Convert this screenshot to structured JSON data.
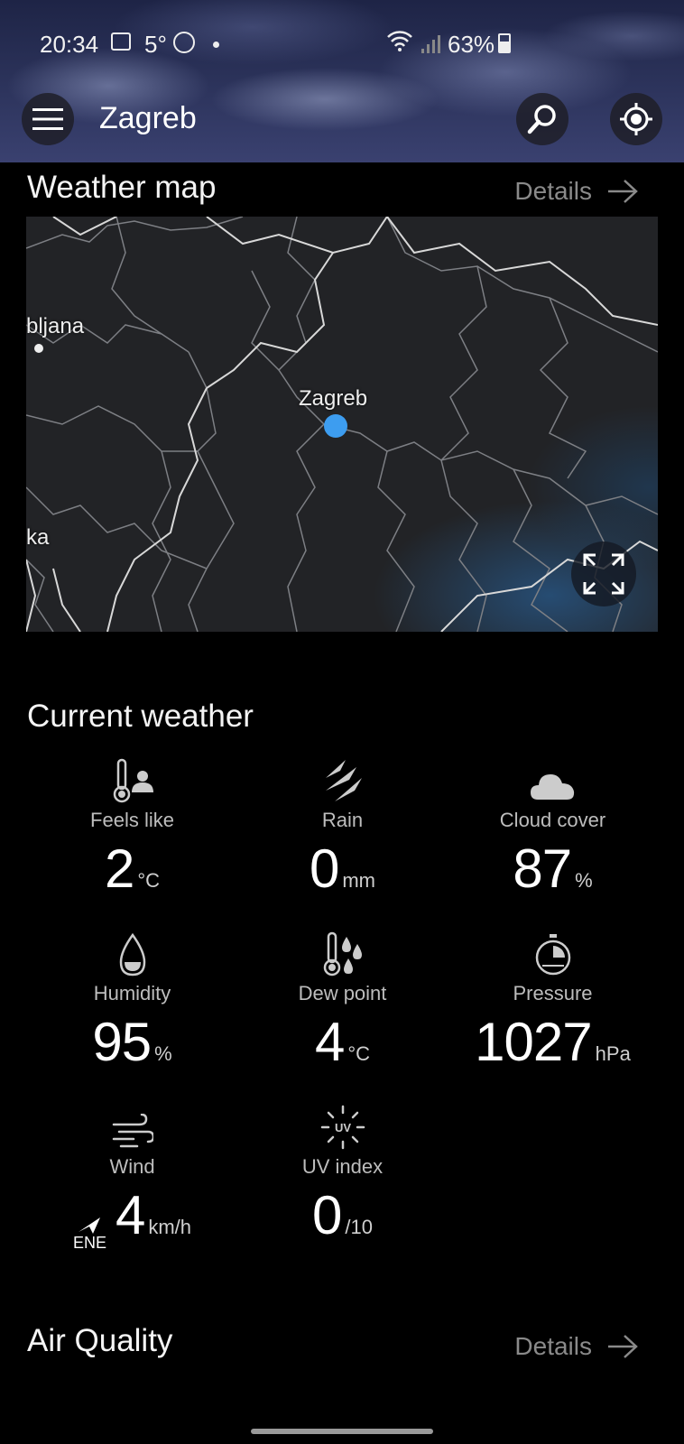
{
  "status_bar": {
    "time": "20:34",
    "temp": "5°",
    "battery": "63%"
  },
  "app_bar": {
    "city": "Zagreb"
  },
  "weather_map": {
    "title": "Weather map",
    "details_label": "Details",
    "labels": {
      "ljubljana": "bljana",
      "zagreb": "Zagreb",
      "rijeka": "ka"
    }
  },
  "current_weather": {
    "title": "Current weather",
    "items": [
      {
        "label": "Feels like",
        "value": "2",
        "unit": "°C",
        "icon": "thermometer-person-icon"
      },
      {
        "label": "Rain",
        "value": "0",
        "unit": "mm",
        "icon": "rain-icon"
      },
      {
        "label": "Cloud cover",
        "value": "87",
        "unit": "%",
        "icon": "cloud-icon"
      },
      {
        "label": "Humidity",
        "value": "95",
        "unit": "%",
        "icon": "droplet-icon"
      },
      {
        "label": "Dew point",
        "value": "4",
        "unit": "°C",
        "icon": "thermometer-drops-icon"
      },
      {
        "label": "Pressure",
        "value": "1027",
        "unit": "hPa",
        "icon": "gauge-icon"
      },
      {
        "label": "Wind",
        "value": "4",
        "unit": "km/h",
        "direction": "ENE",
        "icon": "wind-icon"
      },
      {
        "label": "UV index",
        "value": "0",
        "unit": "/10",
        "icon": "uv-icon"
      }
    ]
  },
  "air_quality": {
    "title": "Air Quality",
    "details_label": "Details"
  }
}
